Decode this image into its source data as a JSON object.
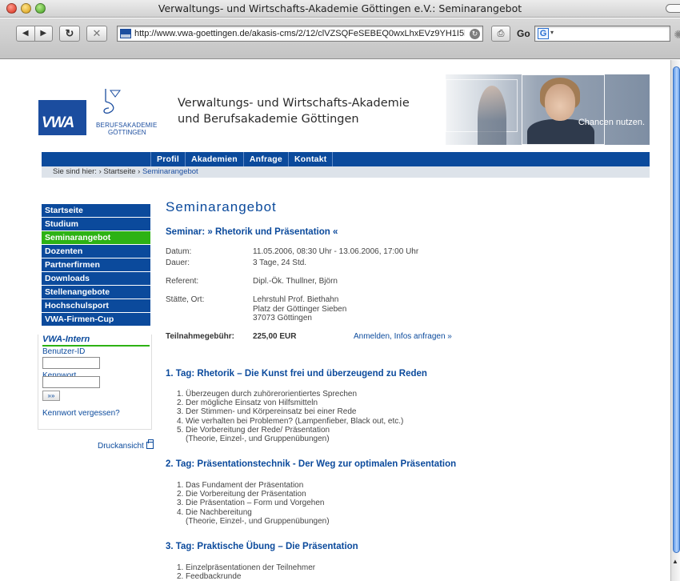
{
  "window": {
    "title": "Verwaltungs- und Wirtschafts-Akademie Göttingen e.V.: Seminarangebot"
  },
  "toolbar": {
    "back_label": "◀",
    "forward_label": "▶",
    "reload_label": "↻",
    "stop_label": "✕",
    "url": "http://www.vwa-goettingen.de/akasis-cms/2/12/clVZSQFeSEBEQ0wxLhxEVz9YH1I5l",
    "go_label": "Go",
    "print_icon": "print-icon",
    "search_engine_icon": "G"
  },
  "header": {
    "logo_mark": "VWA",
    "logo_line1": "BERUFSAKADEMIE",
    "logo_line2": "GÖTTINGEN",
    "academy_line1": "Verwaltungs- und Wirtschafts-Akademie",
    "academy_line2": "und Berufsakademie Göttingen",
    "slogan": "Chancen nutzen."
  },
  "nav": {
    "items": [
      {
        "label": "Profil"
      },
      {
        "label": "Akademien"
      },
      {
        "label": "Anfrage"
      },
      {
        "label": "Kontakt"
      }
    ]
  },
  "breadcrumb": {
    "prefix": "Sie sind hier:",
    "sep1": "›",
    "home": "Startseite",
    "sep2": "›",
    "current": "Seminarangebot"
  },
  "sidebar": {
    "items": [
      {
        "label": "Startseite"
      },
      {
        "label": "Studium"
      },
      {
        "label": "Seminarangebot"
      },
      {
        "label": "Dozenten"
      },
      {
        "label": "Partnerfirmen"
      },
      {
        "label": "Downloads"
      },
      {
        "label": "Stellenangebote"
      },
      {
        "label": "Hochschulsport"
      },
      {
        "label": "VWA-Firmen-Cup"
      }
    ],
    "login": {
      "title": "VWA-Intern",
      "user_label": "Benutzer-ID",
      "user_value": "",
      "pass_label": "Kennwort",
      "pass_value": "",
      "submit_label": "»»",
      "forgot": "Kennwort vergessen?"
    },
    "print_view": "Druckansicht"
  },
  "content": {
    "title": "Seminarangebot",
    "seminar": "Seminar: » Rhetorik und Präsentation «",
    "info": [
      {
        "label": "Datum:",
        "value": "11.05.2006, 08:30 Uhr - 13.06.2006, 17:00 Uhr"
      },
      {
        "label": "Dauer:",
        "value": "3 Tage, 24 Std."
      },
      {
        "label": "Referent:",
        "value": "Dipl.-Ök. Thullner, Björn"
      },
      {
        "label": "Stätte, Ort:",
        "value_lines": [
          "Lehrstuhl Prof. Biethahn",
          "Platz der Göttinger Sieben",
          "37073 Göttingen"
        ]
      }
    ],
    "fee_label": "Teilnahmegebühr:",
    "fee_value": "225,00 EUR",
    "register_link": "Anmelden, Infos anfragen »",
    "days": [
      {
        "title": "1. Tag: Rhetorik – Die Kunst frei und überzeugend zu Reden",
        "items": [
          {
            "num": "1.",
            "lines": [
              "Überzeugen durch zuhörerorientiertes Sprechen"
            ]
          },
          {
            "num": "2.",
            "lines": [
              "Der mögliche Einsatz von Hilfsmitteln"
            ]
          },
          {
            "num": "3.",
            "lines": [
              " Der Stimmen- und Körpereinsatz bei einer Rede"
            ]
          },
          {
            "num": "4.",
            "lines": [
              " Wie verhalten bei Problemen? (Lampenfieber, Black out, etc.)"
            ]
          },
          {
            "num": "5.",
            "lines": [
              "Die Vorbereitung der Rede/ Präsentation",
              "(Theorie, Einzel-, und Gruppenübungen)"
            ]
          }
        ]
      },
      {
        "title": "2. Tag: Präsentationstechnik -  Der Weg zur optimalen Präsentation",
        "items": [
          {
            "num": "1.",
            "lines": [
              "Das Fundament der Präsentation"
            ]
          },
          {
            "num": "2.",
            "lines": [
              "Die Vorbereitung der Präsentation"
            ]
          },
          {
            "num": "3.",
            "lines": [
              "Die Präsentation – Form und Vorgehen"
            ]
          },
          {
            "num": "4.",
            "lines": [
              "Die Nachbereitung",
              "(Theorie, Einzel-, und Gruppenübungen)"
            ]
          }
        ]
      },
      {
        "title": "3. Tag: Praktische Übung – Die Präsentation",
        "items": [
          {
            "num": "1.",
            "lines": [
              "Einzelpräsentationen der Teilnehmer"
            ]
          },
          {
            "num": "2.",
            "lines": [
              "Feedbackrunde"
            ]
          }
        ]
      }
    ]
  },
  "colors": {
    "nav_blue": "#0b4a9c",
    "active_green": "#2db214",
    "breadcrumb_bg": "#dde3ea"
  }
}
